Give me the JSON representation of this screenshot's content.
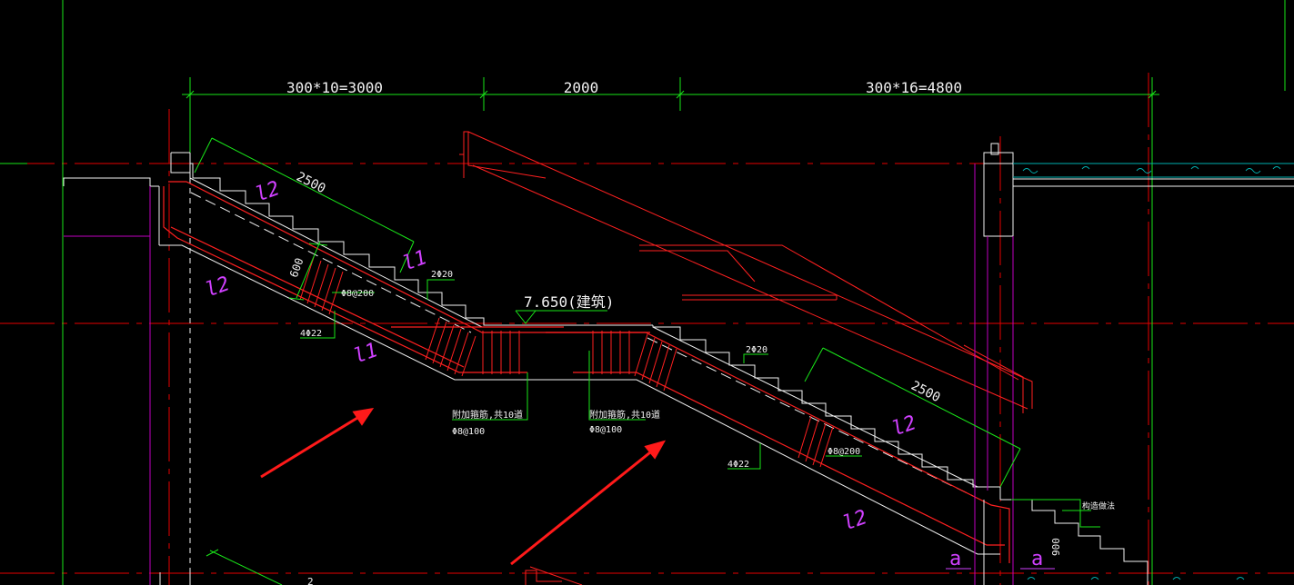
{
  "colors": {
    "background": "#000000",
    "grid_red": "#e60000",
    "rebar_red": "#ff2020",
    "dim_green": "#19e619",
    "outline_white": "#f2f2f2",
    "label_magenta": "#d040ff",
    "pillar_magenta": "#c000c0",
    "slab_cyan": "#00b0b0",
    "arrow_red": "#ff1a1a"
  },
  "dimensions": {
    "left_span": "300*10=3000",
    "mid_span": "2000",
    "right_span": "300*16=4800"
  },
  "elevation": {
    "label": "7.650(建筑)"
  },
  "labels": {
    "flight_len_left": "2500",
    "flight_len_right": "2500",
    "height_600": "600",
    "height_900": "900",
    "top_bar_left": "2Φ20",
    "top_bar_right": "2Φ20",
    "stirrup_left": "Φ8@200",
    "stirrup_right": "Φ8@200",
    "bottom_bar_left": "4Φ22",
    "bottom_bar_right": "4Φ22",
    "added_bars_left_1": "附加箍筋,共10道",
    "added_bars_left_2": "Φ8@100",
    "added_bars_right_1": "附加箍筋,共10道",
    "added_bars_right_2": "Φ8@100",
    "note_right": "构造做法",
    "bottom_cut": "2"
  },
  "section_marks": {
    "l2_a": "l2",
    "l1_a": "l1",
    "l2_b": "l2",
    "l1_b": "l1",
    "l2_c": "l2",
    "l2_d": "l2",
    "a_left": "a",
    "a_right": "a"
  },
  "icons": {
    "arrow": "red-pointer-arrow"
  }
}
